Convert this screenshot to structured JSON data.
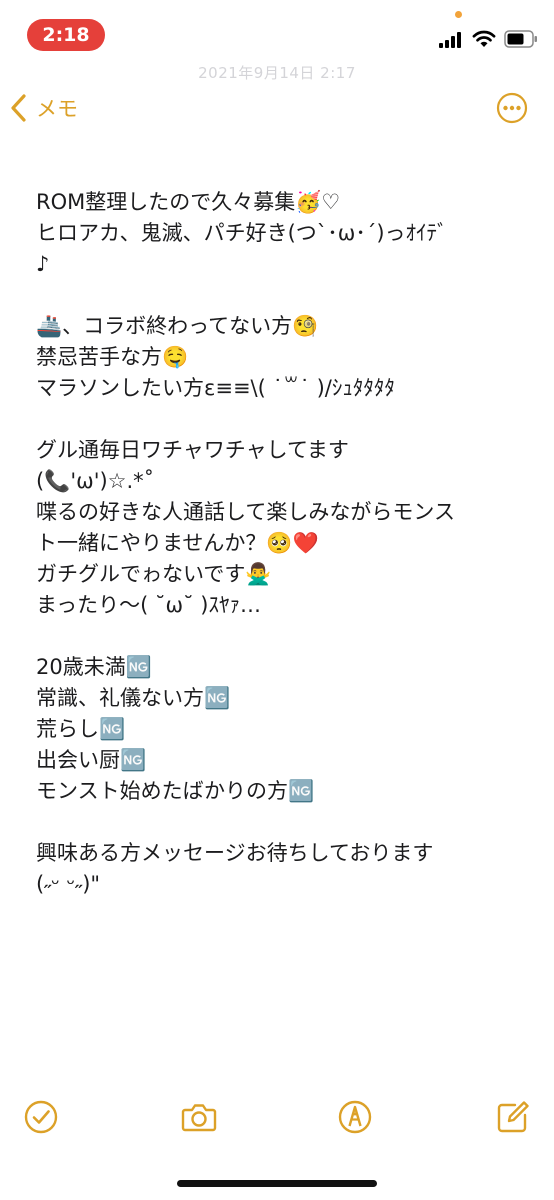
{
  "status_bar": {
    "time": "2:18"
  },
  "header": {
    "date_faint": "2021年9月14日 2:17",
    "back_label": "メモ"
  },
  "note": {
    "lines": [
      "ROM整理したので久々募集🥳♡",
      "ヒロアカ、鬼滅、パチ好き(つ`･ω･´)っｵｲﾃﾞ",
      "♪",
      "",
      "🚢、コラボ終わってない方🧐",
      "禁忌苦手な方🤤",
      "マラソンしたい方ε≡≡\\( ˙꒳˙ )/ｼｭﾀﾀﾀﾀ",
      "",
      "グル通毎日ワチャワチャしてます",
      "(📞'ω')☆.*˚",
      "喋るの好きな人通話して楽しみながらモンス",
      "ト一緒にやりませんか？🥺❤️",
      "ガチグルでゎないです🙅‍♂️",
      "まったり〜( ˘ω˘ )ｽﾔｧ…",
      "",
      "20歳未満🆖",
      "常識、礼儀ない方🆖",
      "荒らし🆖",
      "出会い厨🆖",
      "モンスト始めたばかりの方🆖",
      "",
      "興味ある方メッセージお待ちしております",
      "(˶ᵕ ᵕ˶)\""
    ]
  },
  "toolbar": {
    "icons": [
      "checklist-icon",
      "camera-icon",
      "markup-pen-icon",
      "compose-icon"
    ]
  },
  "colors": {
    "accent": "#dca128",
    "time_pill": "#e5403a",
    "text": "#1c1c1e"
  }
}
